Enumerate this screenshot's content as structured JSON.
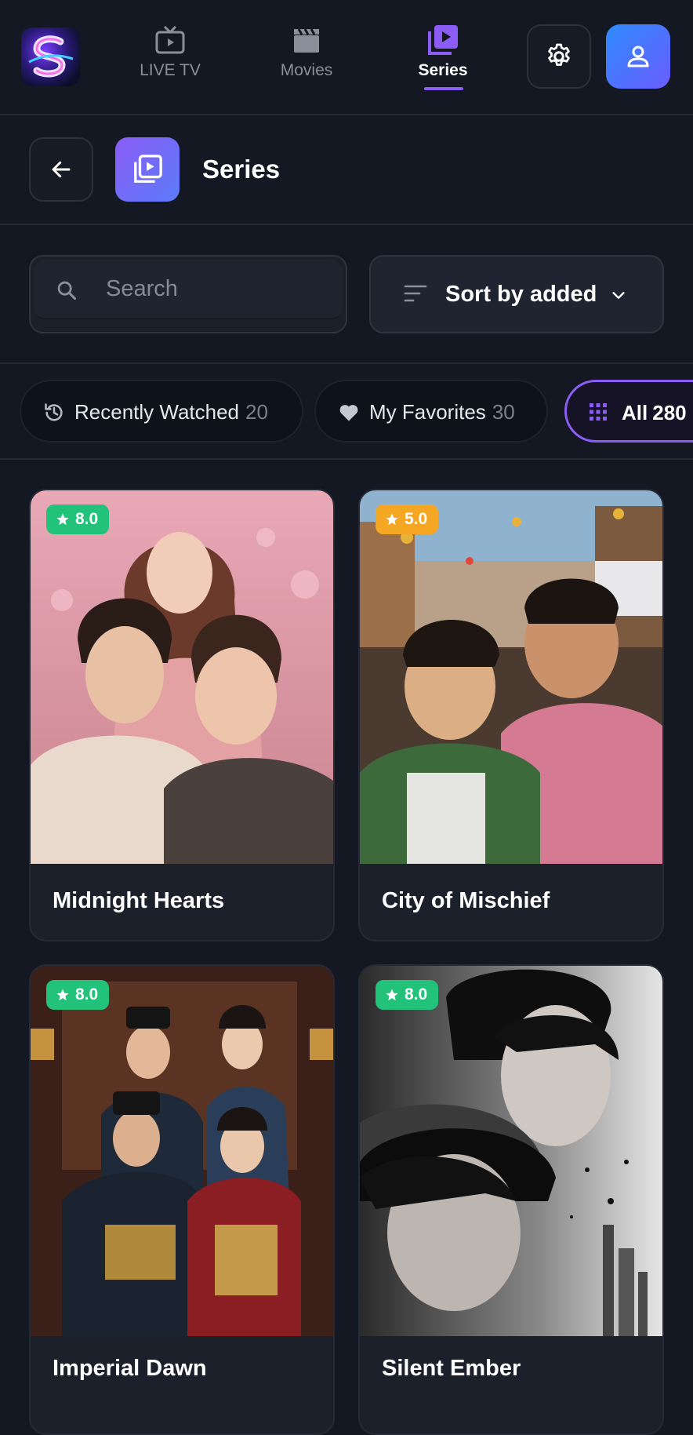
{
  "nav": {
    "items": [
      {
        "label": "LIVE TV",
        "icon": "tv-icon"
      },
      {
        "label": "Movies",
        "icon": "clapperboard-icon"
      },
      {
        "label": "Series",
        "icon": "play-stack-icon",
        "active": true
      }
    ],
    "accent": "#8b5cf6"
  },
  "header": {
    "title": "Series"
  },
  "search": {
    "placeholder": "Search"
  },
  "sort": {
    "label": "Sort by added"
  },
  "chips": [
    {
      "label": "Recently Watched",
      "count": "20"
    },
    {
      "label": "My Favorites",
      "count": "30"
    },
    {
      "label": "All",
      "count": "280"
    }
  ],
  "cards": [
    {
      "title": "Midnight Hearts",
      "rating": "8.0",
      "rating_color": "#22c27a"
    },
    {
      "title": "City of Mischief",
      "rating": "5.0",
      "rating_color": "#f5a623"
    },
    {
      "title": "Imperial Dawn",
      "rating": "8.0",
      "rating_color": "#22c27a"
    },
    {
      "title": "Silent Ember",
      "rating": "8.0",
      "rating_color": "#22c27a"
    }
  ]
}
